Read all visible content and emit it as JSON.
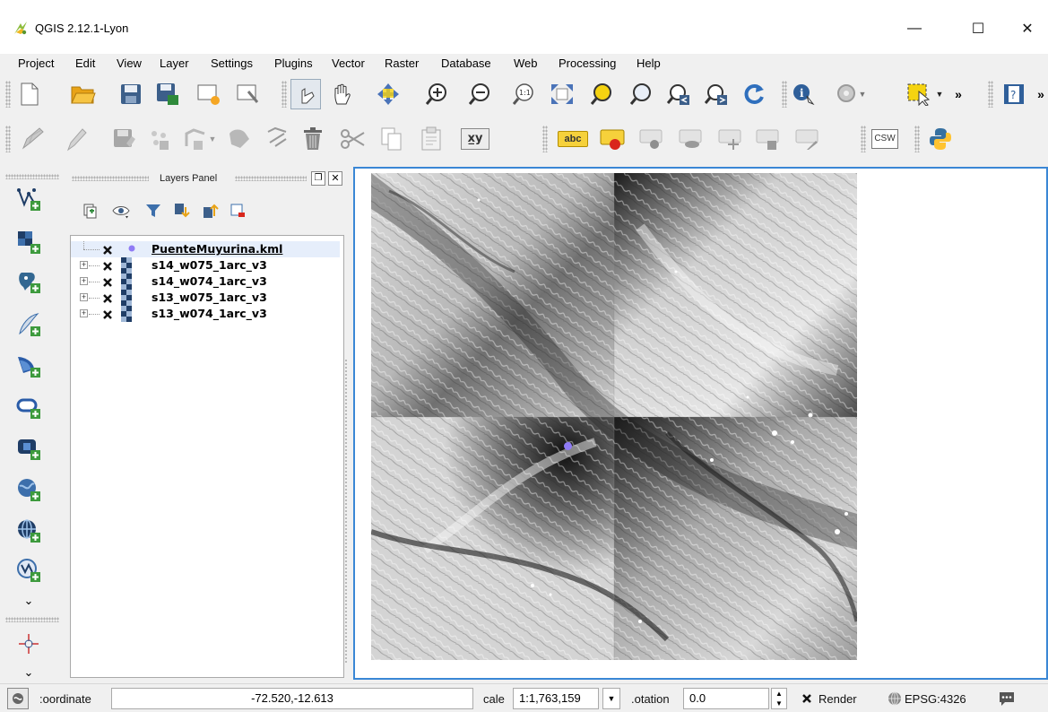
{
  "window": {
    "title": "QGIS 2.12.1-Lyon",
    "minimize": "—",
    "maximize": "☐",
    "close": "✕"
  },
  "menu": [
    "Project",
    "Edit",
    "View",
    "Layer",
    "Settings",
    "Plugins",
    "Vector",
    "Raster",
    "Database",
    "Web",
    "Processing",
    "Help"
  ],
  "toolbar": {
    "more_label": "»",
    "xy_label": "x̲y",
    "abc_label": "abc",
    "csw_label": "CSW"
  },
  "layers_panel": {
    "title": "Layers Panel",
    "layers": [
      {
        "name": "PuenteMuyurina.kml",
        "type": "point",
        "checked": true,
        "selected": true
      },
      {
        "name": "s14_w075_1arc_v3",
        "type": "raster",
        "checked": true,
        "selected": false
      },
      {
        "name": "s14_w074_1arc_v3",
        "type": "raster",
        "checked": true,
        "selected": false
      },
      {
        "name": "s13_w075_1arc_v3",
        "type": "raster",
        "checked": true,
        "selected": false
      },
      {
        "name": "s13_w074_1arc_v3",
        "type": "raster",
        "checked": true,
        "selected": false
      }
    ]
  },
  "status": {
    "coordinate_label": ":oordinate",
    "coordinate_value": "-72.520,-12.613",
    "scale_label": "cale",
    "scale_value": "1:1,763,159",
    "rotation_label": ".otation",
    "rotation_value": "0.0",
    "render_label": "Render",
    "crs_label": "EPSG:4326"
  },
  "colors": {
    "accent": "#3a87d5",
    "point_marker": "#8f7bf5",
    "map_background": "#ffffff"
  }
}
